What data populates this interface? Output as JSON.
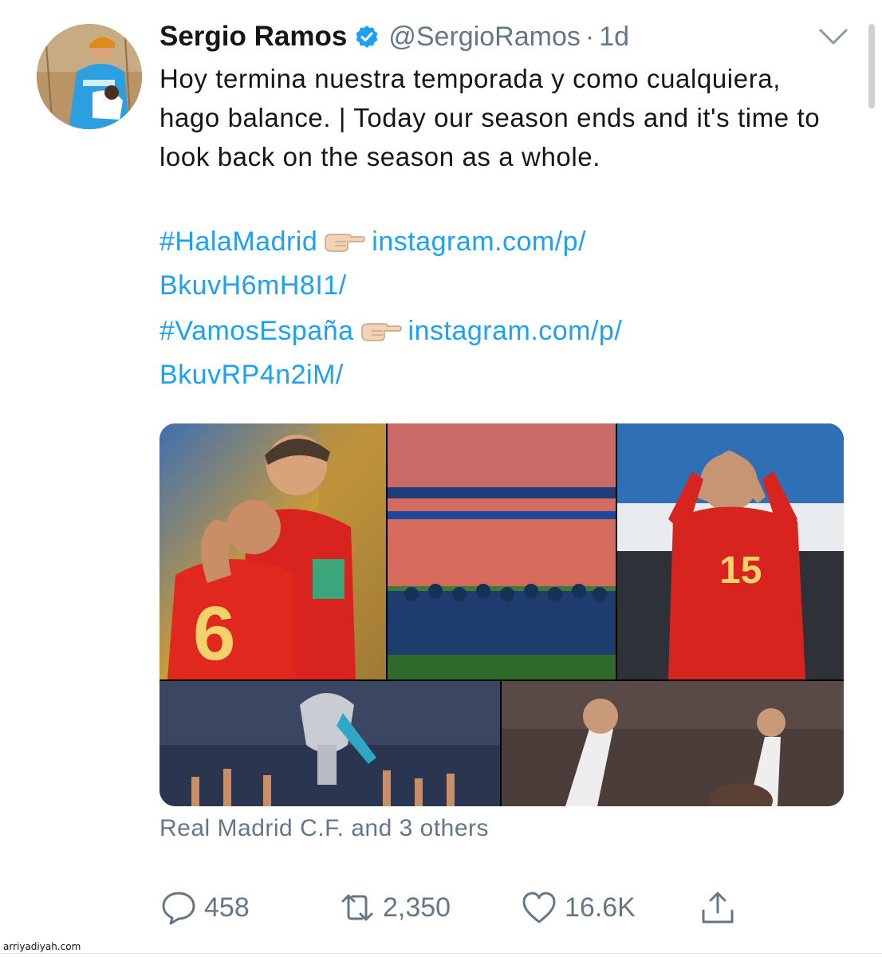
{
  "tweet": {
    "display_name": "Sergio Ramos",
    "handle": "@SergioRamos",
    "separator": "·",
    "time": "1d",
    "text": "Hoy termina nuestra temporada y como cualquiera, hago balance. | Today our season ends and it's time to look back on the season as a whole.",
    "links": [
      {
        "hashtag": "#HalaMadrid",
        "url_line1": "instagram.com/p/",
        "url_line2": "BkuvH6mH8I1/"
      },
      {
        "hashtag": "#VamosEspaña",
        "url_line1": "instagram.com/p/",
        "url_line2": "BkuvRP4n2iM/"
      }
    ],
    "tagged": "Real Madrid C.F. and 3 others"
  },
  "actions": {
    "reply_count": "458",
    "retweet_count": "2,350",
    "like_count": "16.6K"
  },
  "colors": {
    "link": "#1da1f2",
    "muted": "#657786",
    "text": "#14171a",
    "verified": "#1da1f2"
  },
  "icons": [
    "chevron-down-icon",
    "verified-badge-icon",
    "pointing-hand-icon",
    "reply-icon",
    "retweet-icon",
    "like-icon",
    "share-icon"
  ],
  "watermark": "arriyadiyah.com"
}
